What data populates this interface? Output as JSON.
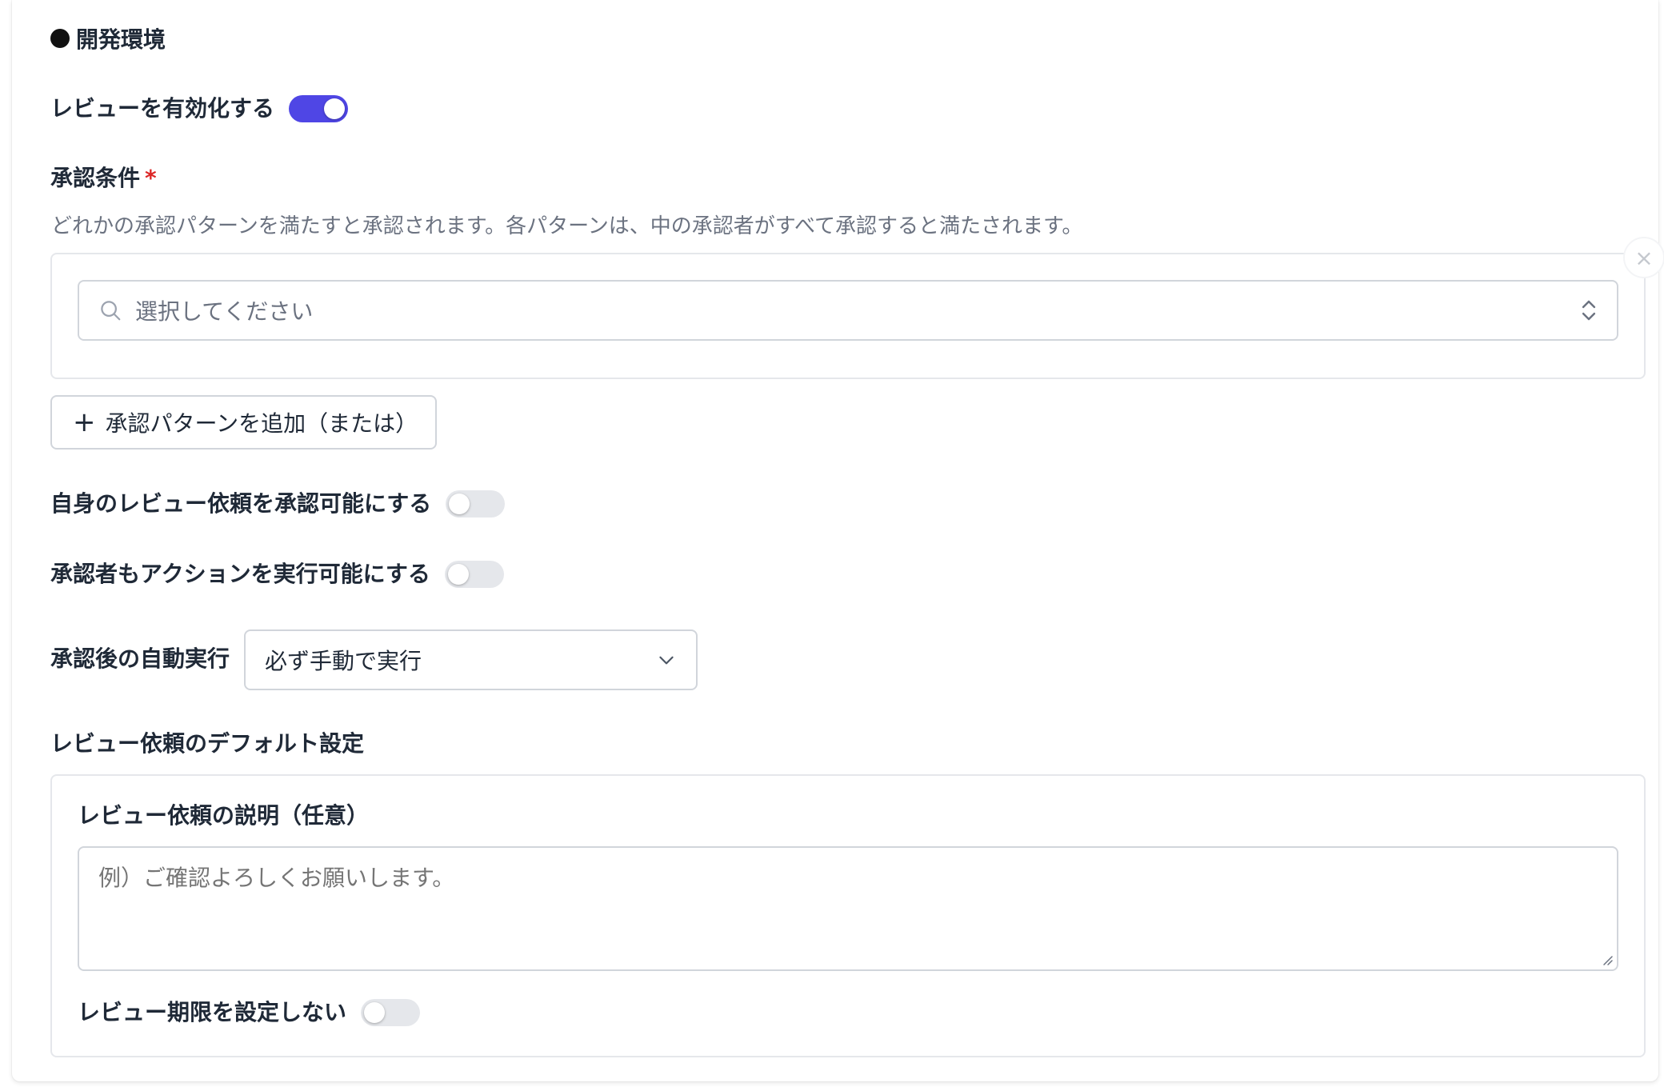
{
  "section": {
    "environment_title": "開発環境"
  },
  "review": {
    "enable_label": "レビューを有効化する",
    "enable_on": true
  },
  "approval": {
    "condition_label": "承認条件",
    "required_mark": "*",
    "description": "どれかの承認パターンを満たすと承認されます。各パターンは、中の承認者がすべて承認すると満たされます。",
    "select_placeholder": "選択してください",
    "close_symbol": "×",
    "add_pattern_plus": "+",
    "add_pattern_label": "承認パターンを追加（または）"
  },
  "toggles": {
    "self_approve_label": "自身のレビュー依頼を承認可能にする",
    "self_approve_on": false,
    "approver_action_label": "承認者もアクションを実行可能にする",
    "approver_action_on": false
  },
  "auto_exec": {
    "label": "承認後の自動実行",
    "selected": "必ず手動で実行"
  },
  "defaults": {
    "section_title": "レビュー依頼のデフォルト設定",
    "description_label": "レビュー依頼の説明（任意）",
    "description_placeholder": "例）ご確認よろしくお願いします。",
    "no_deadline_label": "レビュー期限を設定しない",
    "no_deadline_on": false
  },
  "colors": {
    "accent": "#4f46e5",
    "required": "#dc2626",
    "toggle_off": "#e5e7eb"
  }
}
